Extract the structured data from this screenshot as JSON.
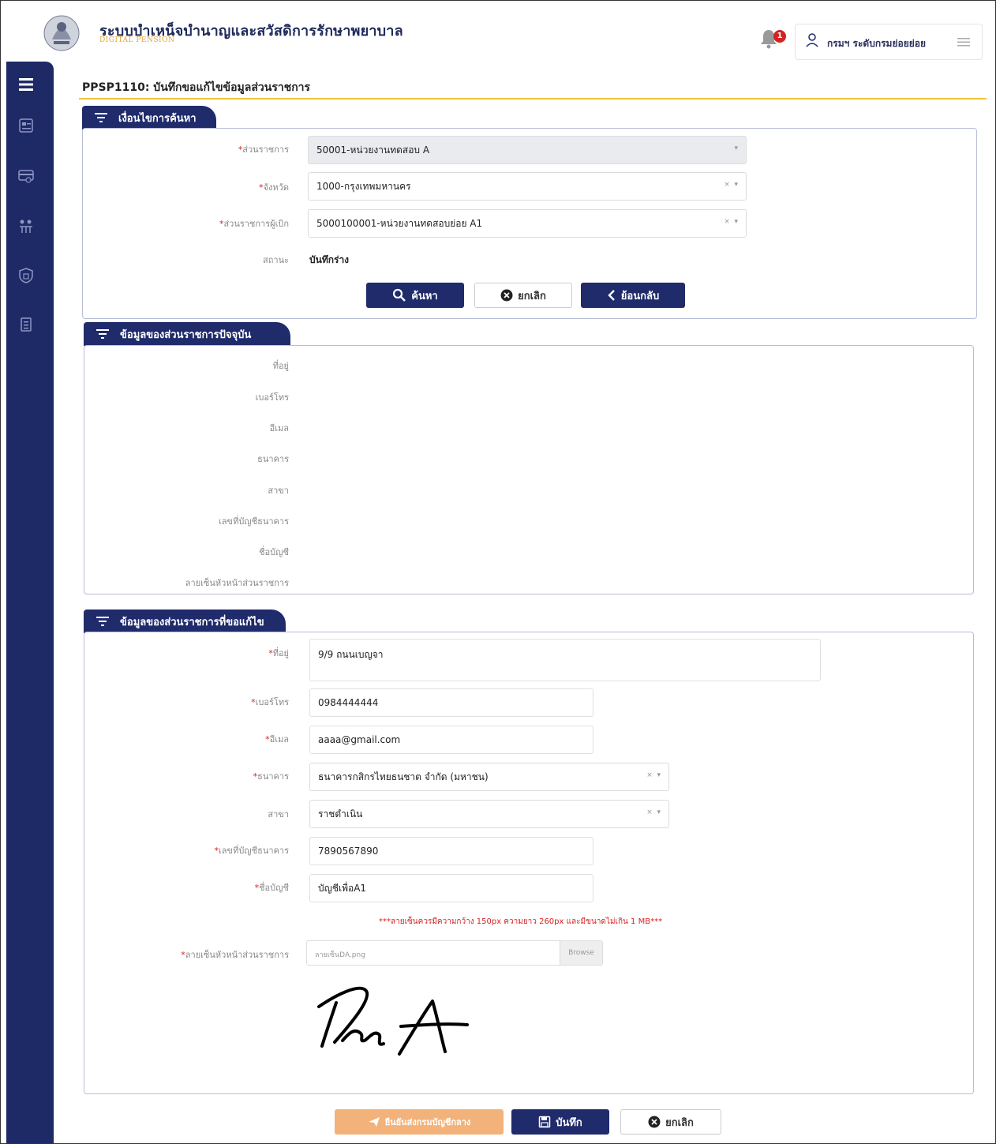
{
  "header": {
    "title": "ระบบบำเหน็จบำนาญและสวัสดิการรักษาพยาบาล",
    "subtitle": "DIGITAL PENSION",
    "notification_count": "1",
    "user_name": "กรมฯ ระดับกรมย่อยย่อย"
  },
  "page": {
    "title": "PPSP1110: บันทึกขอแก้ไขข้อมูลส่วนราชการ"
  },
  "search": {
    "section_title": "เงื่อนไขการค้นหา",
    "agency_label": "ส่วนราชการ",
    "agency_value": "50001-หน่วยงานทดสอบ A",
    "province_label": "จังหวัด",
    "province_value": "1000-กรุงเทพมหานคร",
    "disbursing_label": "ส่วนราชการผู้เบิก",
    "disbursing_value": "5000100001-หน่วยงานทดสอบย่อย A1",
    "status_label": "สถานะ",
    "status_value": "บันทึกร่าง",
    "btn_search": "ค้นหา",
    "btn_cancel": "ยกเลิก",
    "btn_back": "ย้อนกลับ"
  },
  "current": {
    "section_title": "ข้อมูลของส่วนราชการปัจจุบัน",
    "labels": [
      "ที่อยู่",
      "เบอร์โทร",
      "อีเมล",
      "ธนาคาร",
      "สาขา",
      "เลขที่บัญชีธนาคาร",
      "ชื่อบัญชี",
      "ลายเซ็นหัวหน้าส่วนราชการ"
    ]
  },
  "edit": {
    "section_title": "ข้อมูลของส่วนราชการที่ขอแก้ไข",
    "address_label": "ที่อยู่",
    "address_value": "9/9 ถนนเบญจา",
    "phone_label": "เบอร์โทร",
    "phone_value": "0984444444",
    "email_label": "อีเมล",
    "email_value": "aaaa@gmail.com",
    "bank_label": "ธนาคาร",
    "bank_value": "ธนาคารกสิกรไทยธนชาต จำกัด (มหาชน)",
    "branch_label": "สาขา",
    "branch_value": "ราชดำเนิน",
    "account_no_label": "เลขที่บัญชีธนาคาร",
    "account_no_value": "7890567890",
    "account_name_label": "ชื่อบัญชี",
    "account_name_value": "บัญชีเพื่อA1",
    "signature_warning": "***ลายเซ็นควรมีความกว้าง 150px ความยาว 260px และมีขนาดไม่เกิน 1 MB***",
    "signature_label": "ลายเซ็นหัวหน้าส่วนราชการ",
    "signature_file": "ลายเซ็นDA.png",
    "browse_label": "Browse"
  },
  "footer": {
    "btn_submit": "ยืนยันส่งกรมบัญชีกลาง",
    "btn_save": "บันทึก",
    "btn_cancel": "ยกเลิก"
  }
}
